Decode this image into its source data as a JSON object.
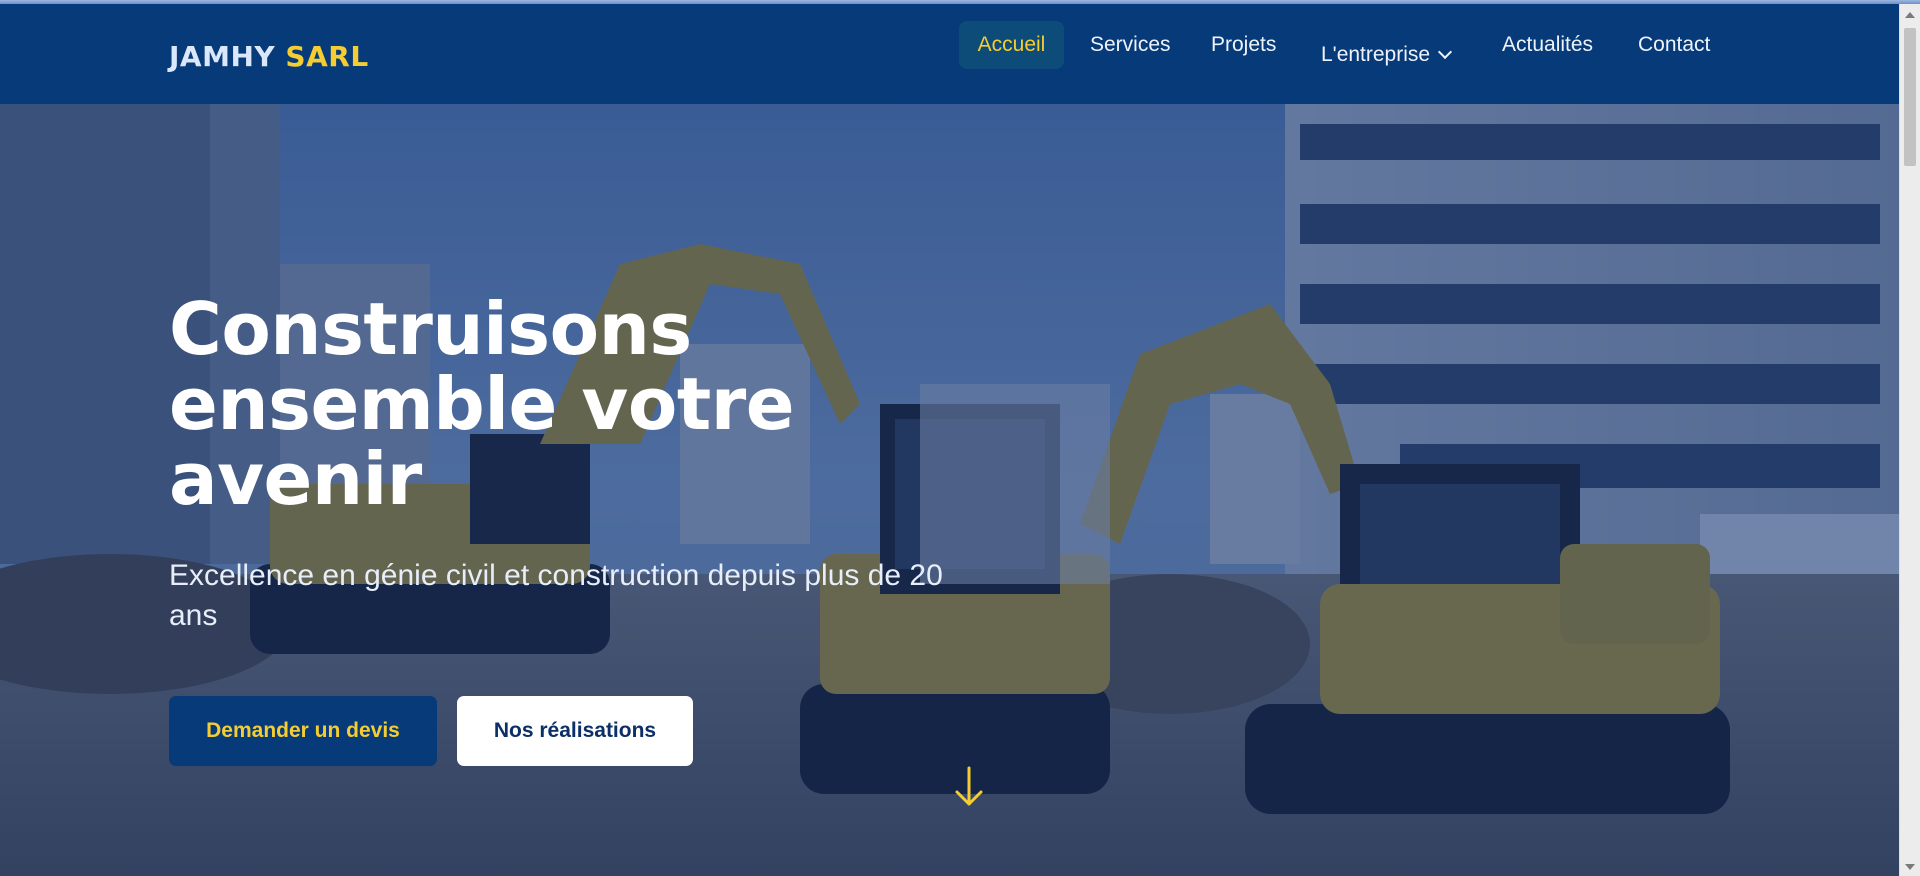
{
  "brand": {
    "name_part1": "JAMHY",
    "name_part2": "SARL"
  },
  "nav": {
    "items": [
      {
        "label": "Accueil",
        "active": true
      },
      {
        "label": "Services"
      },
      {
        "label": "Projets"
      },
      {
        "label": "L'entreprise",
        "has_dropdown": true
      },
      {
        "label": "Actualités"
      },
      {
        "label": "Contact"
      }
    ]
  },
  "hero": {
    "title": "Construisons ensemble votre avenir",
    "subtitle": "Excellence en génie civil et construction depuis plus de 20 ans",
    "primary_cta": "Demander un devis",
    "secondary_cta": "Nos réalisations",
    "background_image": "construction-site-excavators",
    "scroll_icon": "arrow-down-icon"
  },
  "colors": {
    "navy": "#073a78",
    "accent_yellow": "#f5cd32",
    "white": "#ffffff"
  }
}
